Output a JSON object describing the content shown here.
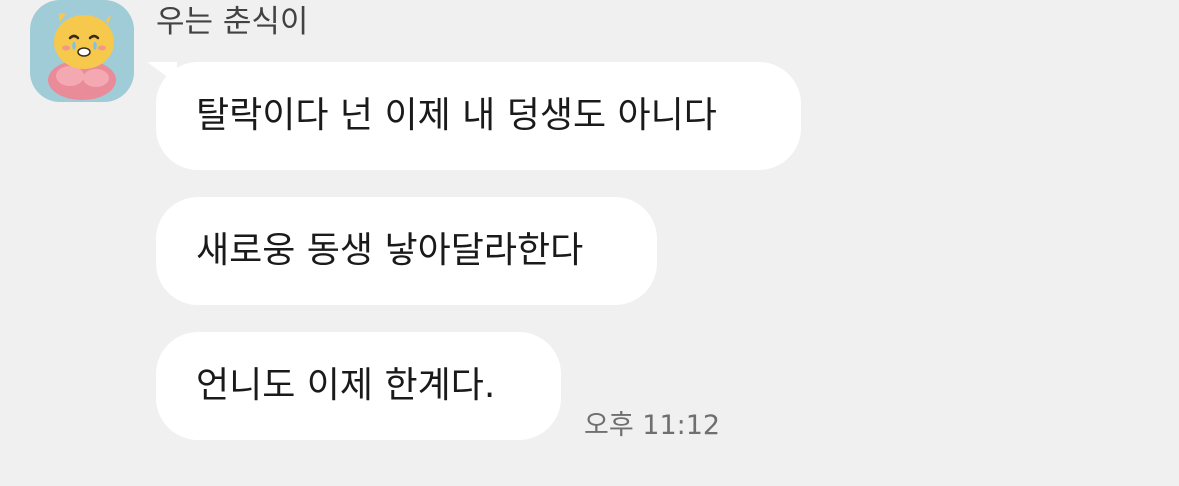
{
  "chat": {
    "sender_name": "우는 춘식이",
    "avatar_icon": "crying-cat-character-icon",
    "messages": [
      {
        "text": "탈락이다 넌 이제 내 덩생도 아니다"
      },
      {
        "text": "새로웅 동생 낳아달라한다"
      },
      {
        "text": "언니도 이제 한계다."
      }
    ],
    "timestamp": "오후 11:12"
  },
  "colors": {
    "background": "#f0f0f0",
    "bubble": "#ffffff",
    "avatar_bg": "#9fccd6",
    "text": "#1a1a1a",
    "meta_text": "#6f6f6f"
  }
}
